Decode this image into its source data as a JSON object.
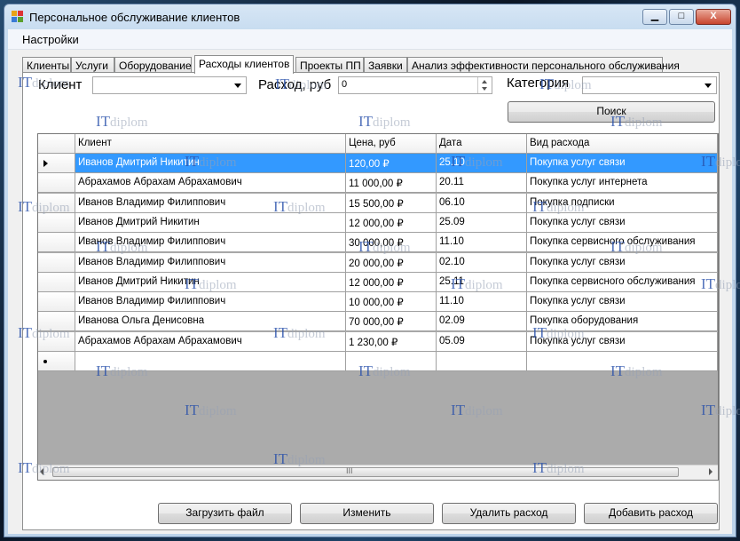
{
  "window": {
    "title": "Персональное обслуживание клиентов",
    "min_glyph": "▁",
    "max_glyph": "□",
    "close_glyph": "X"
  },
  "menu": {
    "settings": "Настройки"
  },
  "tabs": [
    {
      "label": "Клиенты"
    },
    {
      "label": "Услуги"
    },
    {
      "label": "Оборудование"
    },
    {
      "label": "Расходы клиентов",
      "active": true
    },
    {
      "label": "Проекты ПП"
    },
    {
      "label": "Заявки"
    },
    {
      "label": "Анализ эффективности персонального обслуживания"
    }
  ],
  "filters": {
    "client_label": "Клиент",
    "client_value": "",
    "expense_label": "Расход, руб",
    "expense_value": "0",
    "category_label": "Категория",
    "category_value": "",
    "search_button": "Поиск"
  },
  "grid": {
    "columns": [
      "Клиент",
      "Цена, руб",
      "Дата",
      "Вид расхода"
    ],
    "rows": [
      [
        "Иванов Дмитрий Никитин",
        "120,00 ₽",
        "25.10",
        "Покупка услуг связи"
      ],
      [
        "Абрахамов Абрахам Абрахамович",
        "11 000,00 ₽",
        "20.11",
        "Покупка услуг интернета"
      ],
      [
        "Иванов Владимир Филиппович",
        "15 500,00 ₽",
        "06.10",
        "Покупка подписки"
      ],
      [
        "Иванов Дмитрий Никитин",
        "12 000,00 ₽",
        "25.09",
        "Покупка услуг связи"
      ],
      [
        "Иванов Владимир Филиппович",
        "30 000,00 ₽",
        "11.10",
        "Покупка сервисного обслуживания"
      ],
      [
        "Иванов Владимир Филиппович",
        "20 000,00 ₽",
        "02.10",
        "Покупка услуг связи"
      ],
      [
        "Иванов Дмитрий Никитин",
        "12 000,00 ₽",
        "25.11",
        "Покупка сервисного обслуживания"
      ],
      [
        "Иванов Владимир Филиппович",
        "10 000,00 ₽",
        "11.10",
        "Покупка услуг связи"
      ],
      [
        "Иванова Ольга Денисовна",
        "70 000,00 ₽",
        "02.09",
        "Покупка оборудования"
      ],
      [
        "Абрахамов Абрахам Абрахамович",
        "1 230,00 ₽",
        "05.09",
        "Покупка услуг связи"
      ]
    ],
    "scroll_grip": "III"
  },
  "actions": {
    "load_file": "Загрузить файл",
    "edit": "Изменить",
    "delete": "Удалить расход",
    "add": "Добавить расход"
  },
  "watermark": {
    "it": "IT",
    "diplom": "diplom"
  },
  "colors": {
    "selection": "#3399ff",
    "close_button": "#c8442d",
    "grid_empty": "#ababab"
  }
}
